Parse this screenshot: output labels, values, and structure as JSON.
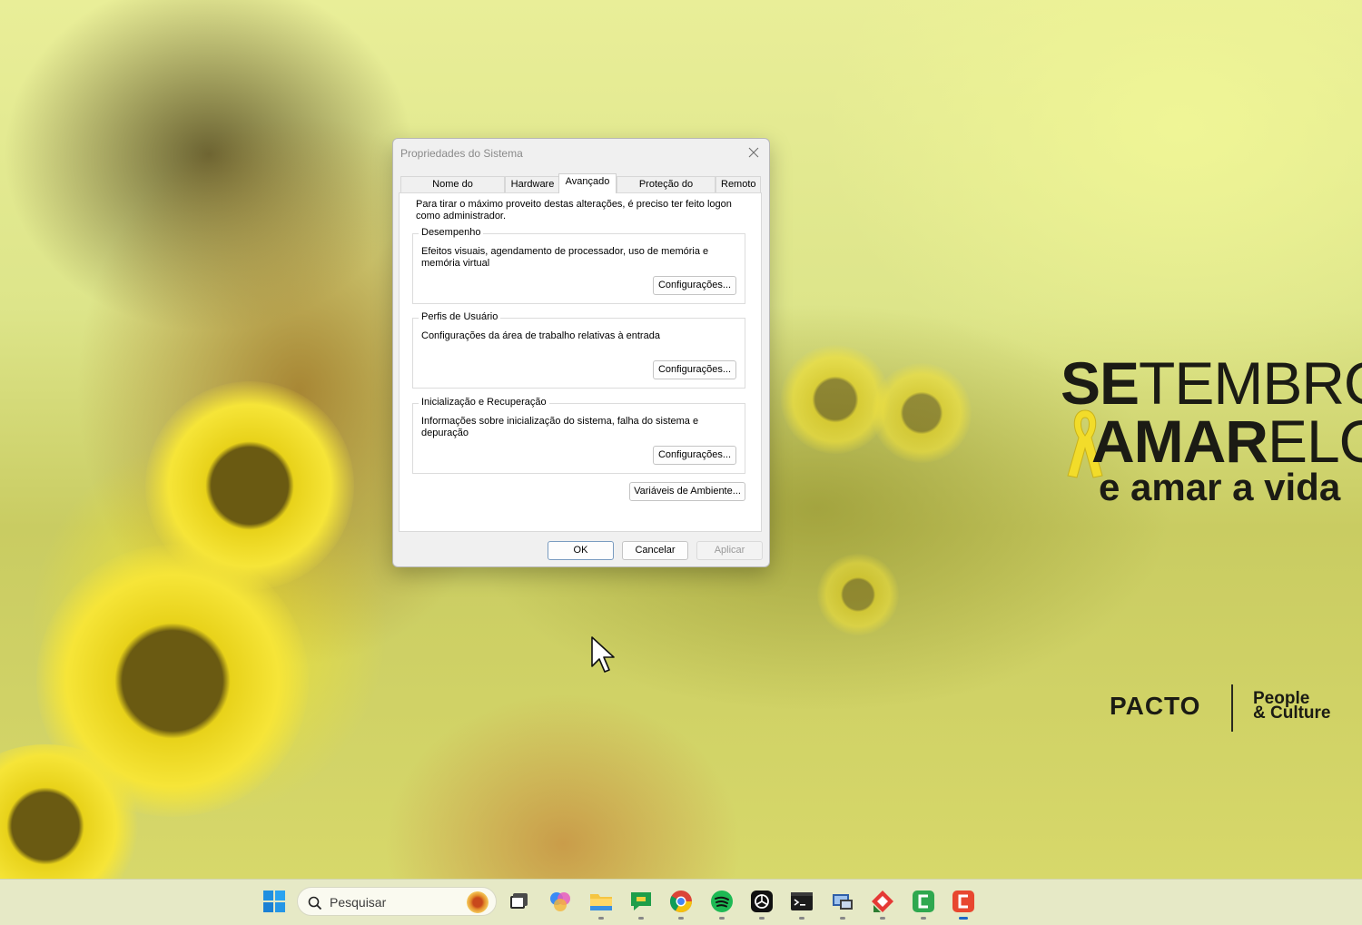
{
  "wallpaper": {
    "line1_bold": "SE",
    "line1_rest": "TEMBRO",
    "line2_bold": "AMAR",
    "line2_rest": "ELO",
    "line3": "e amar a vida",
    "brand": "PACTO",
    "brand_sub_1": "People",
    "brand_sub_2": "& Culture"
  },
  "dialog": {
    "title": "Propriedades do Sistema",
    "tabs": [
      {
        "label": "Nome do Computador"
      },
      {
        "label": "Hardware"
      },
      {
        "label": "Avançado"
      },
      {
        "label": "Proteção do Sistema"
      },
      {
        "label": "Remoto"
      }
    ],
    "active_tab": "Avançado",
    "intro": "Para tirar o máximo proveito destas alterações, é preciso ter feito logon como administrador.",
    "groups": [
      {
        "title": "Desempenho",
        "desc": "Efeitos visuais, agendamento de processador, uso de memória e memória virtual",
        "button": "Configurações..."
      },
      {
        "title": "Perfis de Usuário",
        "desc": "Configurações da área de trabalho relativas à entrada",
        "button": "Configurações..."
      },
      {
        "title": "Inicialização e Recuperação",
        "desc": "Informações sobre inicialização do sistema, falha do sistema e depuração",
        "button": "Configurações..."
      }
    ],
    "env_button": "Variáveis de Ambiente...",
    "ok": "OK",
    "cancel": "Cancelar",
    "apply": "Aplicar"
  },
  "taskbar": {
    "search_placeholder": "Pesquisar",
    "apps": [
      {
        "icon": "start-icon"
      },
      {
        "icon": "task-view-icon"
      },
      {
        "icon": "copilot-icon"
      },
      {
        "icon": "file-explorer-icon"
      },
      {
        "icon": "chat-app-icon"
      },
      {
        "icon": "chrome-icon"
      },
      {
        "icon": "spotify-icon"
      },
      {
        "icon": "chatgpt-icon"
      },
      {
        "icon": "terminal-icon"
      },
      {
        "icon": "remote-desktop-icon"
      },
      {
        "icon": "anydesk-icon"
      },
      {
        "icon": "green-app-icon"
      },
      {
        "icon": "red-app-icon"
      }
    ]
  }
}
